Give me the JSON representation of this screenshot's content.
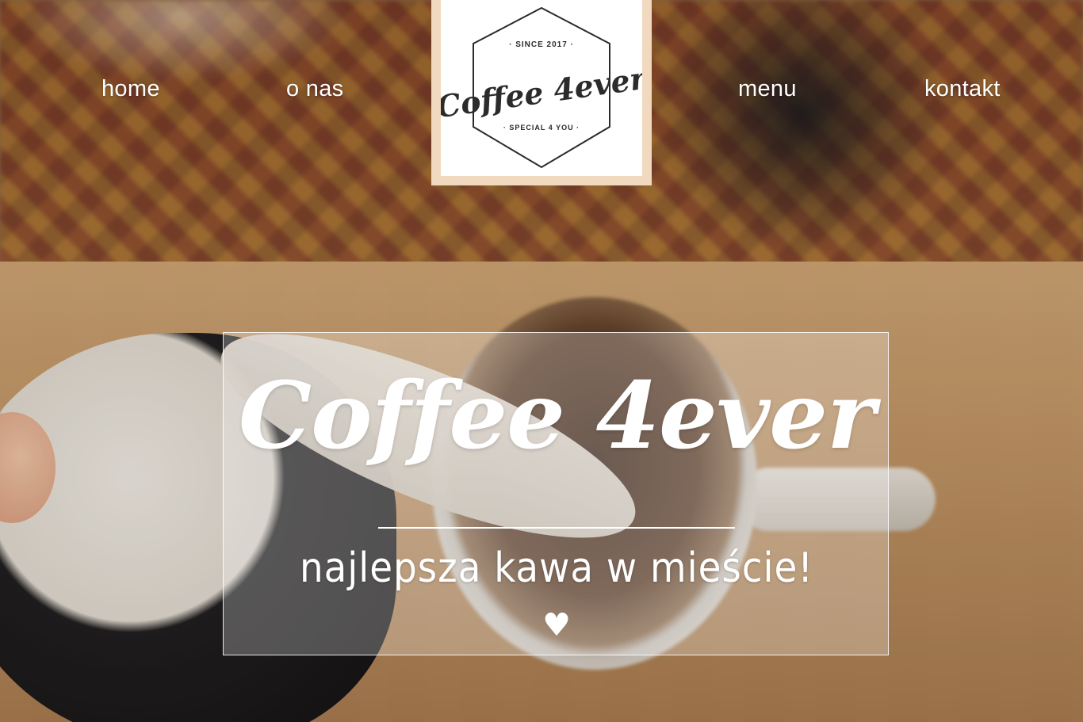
{
  "nav": {
    "items": [
      {
        "label": "home"
      },
      {
        "label": "o nas"
      },
      {
        "label": "menu"
      },
      {
        "label": "kontakt"
      }
    ]
  },
  "logo": {
    "top_text": "· SINCE 2017 ·",
    "name": "Coffee 4ever",
    "bottom_text": "· SPECIAL 4 YOU ·"
  },
  "hero": {
    "title": "Coffee 4ever",
    "subtitle": "najlepsza kawa w mieście!",
    "heart": "♥"
  },
  "colors": {
    "text": "#ffffff",
    "logo_frame": "#f1d9c0",
    "logo_ink": "#2b2b2b"
  }
}
